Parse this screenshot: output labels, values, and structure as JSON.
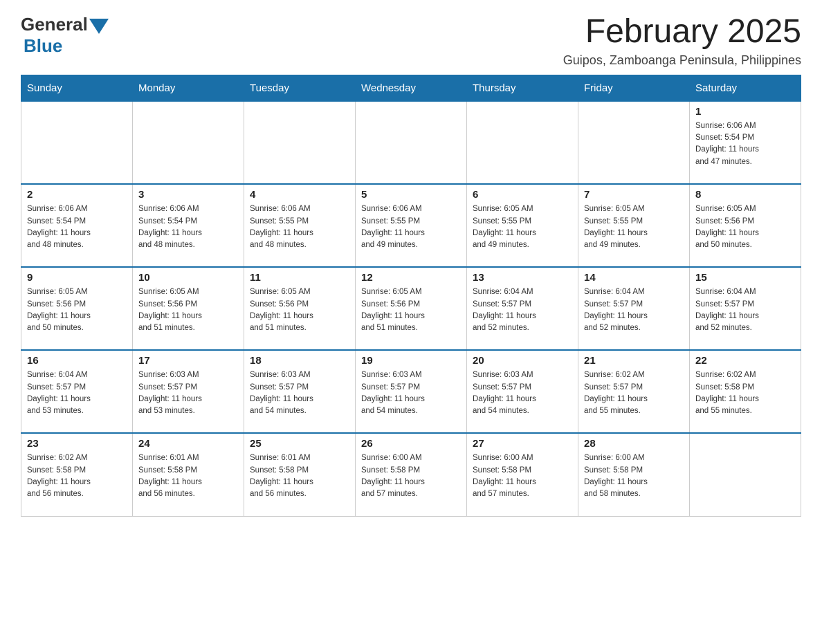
{
  "header": {
    "logo_general": "General",
    "logo_blue": "Blue",
    "month_title": "February 2025",
    "location": "Guipos, Zamboanga Peninsula, Philippines"
  },
  "weekdays": [
    "Sunday",
    "Monday",
    "Tuesday",
    "Wednesday",
    "Thursday",
    "Friday",
    "Saturday"
  ],
  "weeks": [
    [
      {
        "day": "",
        "info": ""
      },
      {
        "day": "",
        "info": ""
      },
      {
        "day": "",
        "info": ""
      },
      {
        "day": "",
        "info": ""
      },
      {
        "day": "",
        "info": ""
      },
      {
        "day": "",
        "info": ""
      },
      {
        "day": "1",
        "info": "Sunrise: 6:06 AM\nSunset: 5:54 PM\nDaylight: 11 hours\nand 47 minutes."
      }
    ],
    [
      {
        "day": "2",
        "info": "Sunrise: 6:06 AM\nSunset: 5:54 PM\nDaylight: 11 hours\nand 48 minutes."
      },
      {
        "day": "3",
        "info": "Sunrise: 6:06 AM\nSunset: 5:54 PM\nDaylight: 11 hours\nand 48 minutes."
      },
      {
        "day": "4",
        "info": "Sunrise: 6:06 AM\nSunset: 5:55 PM\nDaylight: 11 hours\nand 48 minutes."
      },
      {
        "day": "5",
        "info": "Sunrise: 6:06 AM\nSunset: 5:55 PM\nDaylight: 11 hours\nand 49 minutes."
      },
      {
        "day": "6",
        "info": "Sunrise: 6:05 AM\nSunset: 5:55 PM\nDaylight: 11 hours\nand 49 minutes."
      },
      {
        "day": "7",
        "info": "Sunrise: 6:05 AM\nSunset: 5:55 PM\nDaylight: 11 hours\nand 49 minutes."
      },
      {
        "day": "8",
        "info": "Sunrise: 6:05 AM\nSunset: 5:56 PM\nDaylight: 11 hours\nand 50 minutes."
      }
    ],
    [
      {
        "day": "9",
        "info": "Sunrise: 6:05 AM\nSunset: 5:56 PM\nDaylight: 11 hours\nand 50 minutes."
      },
      {
        "day": "10",
        "info": "Sunrise: 6:05 AM\nSunset: 5:56 PM\nDaylight: 11 hours\nand 51 minutes."
      },
      {
        "day": "11",
        "info": "Sunrise: 6:05 AM\nSunset: 5:56 PM\nDaylight: 11 hours\nand 51 minutes."
      },
      {
        "day": "12",
        "info": "Sunrise: 6:05 AM\nSunset: 5:56 PM\nDaylight: 11 hours\nand 51 minutes."
      },
      {
        "day": "13",
        "info": "Sunrise: 6:04 AM\nSunset: 5:57 PM\nDaylight: 11 hours\nand 52 minutes."
      },
      {
        "day": "14",
        "info": "Sunrise: 6:04 AM\nSunset: 5:57 PM\nDaylight: 11 hours\nand 52 minutes."
      },
      {
        "day": "15",
        "info": "Sunrise: 6:04 AM\nSunset: 5:57 PM\nDaylight: 11 hours\nand 52 minutes."
      }
    ],
    [
      {
        "day": "16",
        "info": "Sunrise: 6:04 AM\nSunset: 5:57 PM\nDaylight: 11 hours\nand 53 minutes."
      },
      {
        "day": "17",
        "info": "Sunrise: 6:03 AM\nSunset: 5:57 PM\nDaylight: 11 hours\nand 53 minutes."
      },
      {
        "day": "18",
        "info": "Sunrise: 6:03 AM\nSunset: 5:57 PM\nDaylight: 11 hours\nand 54 minutes."
      },
      {
        "day": "19",
        "info": "Sunrise: 6:03 AM\nSunset: 5:57 PM\nDaylight: 11 hours\nand 54 minutes."
      },
      {
        "day": "20",
        "info": "Sunrise: 6:03 AM\nSunset: 5:57 PM\nDaylight: 11 hours\nand 54 minutes."
      },
      {
        "day": "21",
        "info": "Sunrise: 6:02 AM\nSunset: 5:57 PM\nDaylight: 11 hours\nand 55 minutes."
      },
      {
        "day": "22",
        "info": "Sunrise: 6:02 AM\nSunset: 5:58 PM\nDaylight: 11 hours\nand 55 minutes."
      }
    ],
    [
      {
        "day": "23",
        "info": "Sunrise: 6:02 AM\nSunset: 5:58 PM\nDaylight: 11 hours\nand 56 minutes."
      },
      {
        "day": "24",
        "info": "Sunrise: 6:01 AM\nSunset: 5:58 PM\nDaylight: 11 hours\nand 56 minutes."
      },
      {
        "day": "25",
        "info": "Sunrise: 6:01 AM\nSunset: 5:58 PM\nDaylight: 11 hours\nand 56 minutes."
      },
      {
        "day": "26",
        "info": "Sunrise: 6:00 AM\nSunset: 5:58 PM\nDaylight: 11 hours\nand 57 minutes."
      },
      {
        "day": "27",
        "info": "Sunrise: 6:00 AM\nSunset: 5:58 PM\nDaylight: 11 hours\nand 57 minutes."
      },
      {
        "day": "28",
        "info": "Sunrise: 6:00 AM\nSunset: 5:58 PM\nDaylight: 11 hours\nand 58 minutes."
      },
      {
        "day": "",
        "info": ""
      }
    ]
  ]
}
